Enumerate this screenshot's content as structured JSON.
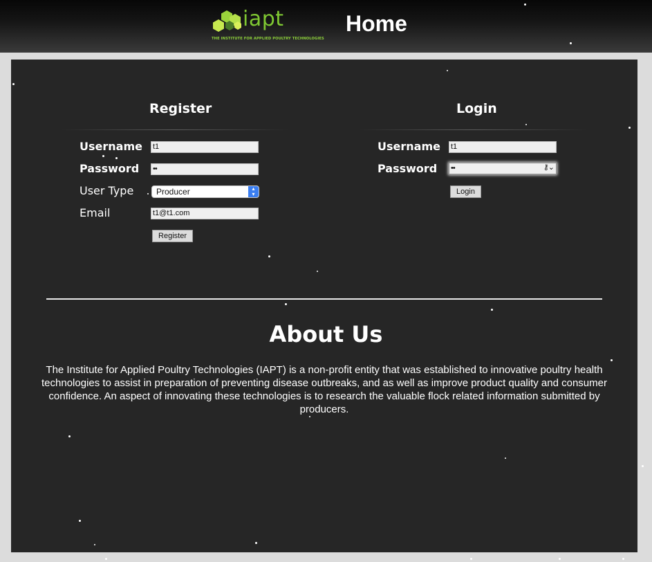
{
  "header": {
    "logo_text": "iapt",
    "logo_subtitle": "THE INSTITUTE FOR APPLIED POULTRY TECHNOLOGIES",
    "page_title": "Home"
  },
  "register": {
    "title": "Register",
    "username_label": "Username",
    "username_value": "t1",
    "password_label": "Password",
    "password_value": "••",
    "user_type_label": "User Type",
    "user_type_value": "Producer",
    "email_label": "Email",
    "email_value": "t1@t1.com",
    "submit_label": "Register"
  },
  "login": {
    "title": "Login",
    "username_label": "Username",
    "username_value": "t1",
    "password_label": "Password",
    "password_value": "••",
    "submit_label": "Login"
  },
  "about": {
    "title": "About Us",
    "body": "The Institute for Applied Poultry Technologies (IAPT) is a non-profit entity that was established to innovative poultry health technologies to assist in preparation of preventing disease outbreaks, and as well as improve product quality and consumer confidence. An aspect of innovating these technologies is to research the valuable flock related information submitted by producers."
  },
  "colors": {
    "panel_bg": "#262626",
    "logo_green": "#7fc832",
    "select_accent": "#3b7ff2"
  },
  "icons": {
    "password_manager": "key-icon",
    "select_arrows": "chevron-up-down-icon"
  }
}
